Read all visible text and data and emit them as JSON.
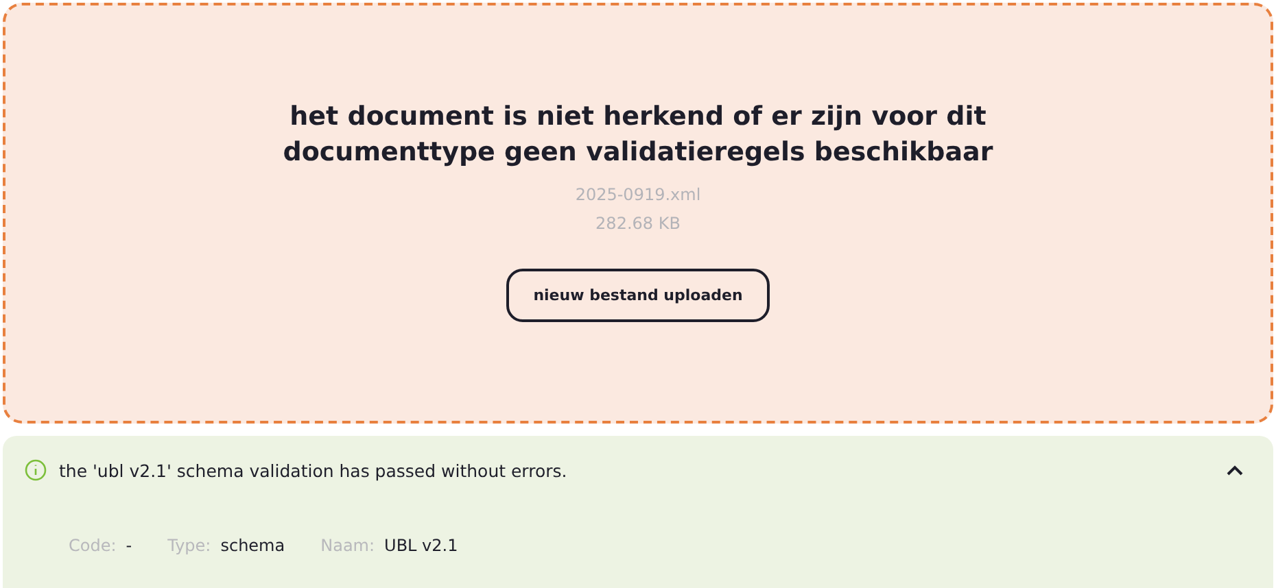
{
  "upload_result": {
    "title": "het document is niet herkend of er zijn voor dit documenttype geen validatieregels beschikbaar",
    "file_name": "2025-0919.xml",
    "file_size": "282.68 KB",
    "button": "nieuw bestand uploaden"
  },
  "validation_panel": {
    "message": "the 'ubl v2.1' schema validation has passed without errors.",
    "expanded": true,
    "details": [
      {
        "label": "Code:",
        "value": "-"
      },
      {
        "label": "Type:",
        "value": "schema"
      },
      {
        "label": "Naam:",
        "value": "UBL v2.1"
      }
    ]
  }
}
